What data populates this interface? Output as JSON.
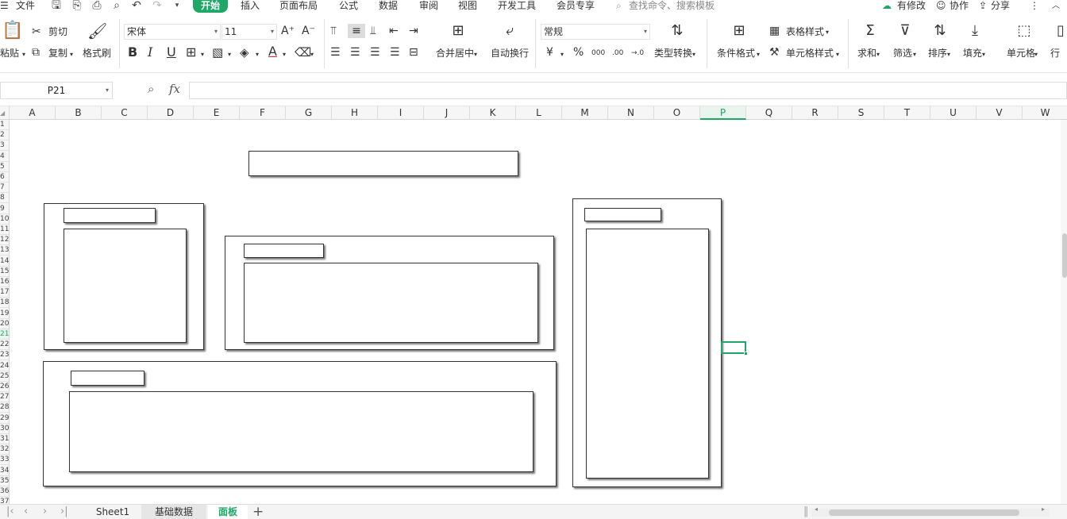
{
  "menu": {
    "file_label": "文件",
    "tabs": [
      "开始",
      "插入",
      "页面布局",
      "公式",
      "数据",
      "审阅",
      "视图",
      "开发工具",
      "会员专享"
    ],
    "search_placeholder": "查找命令、搜索模板",
    "right_items": {
      "modified": "有修改",
      "collab": "协作",
      "share": "分享"
    }
  },
  "ribbon": {
    "paste": "粘贴",
    "cut": "剪切",
    "copy": "复制",
    "format_painter": "格式刷",
    "font_name": "宋体",
    "font_size": "11",
    "merge_center": "合并居中",
    "wrap_text": "自动换行",
    "number_format": "常规",
    "type_convert": "类型转换",
    "conditional_format": "条件格式",
    "table_style": "表格样式",
    "cell_style": "单元格样式",
    "sum": "求和",
    "filter": "筛选",
    "sort": "排序",
    "fill": "填充",
    "cells": "单元格",
    "rows_cols": "行",
    "font_buttons": [
      "B",
      "I",
      "U"
    ],
    "currency_symbol": "¥",
    "percent_symbol": "%",
    "thousands_symbol": "000",
    "dec_increase": ".00",
    "dec_decrease": "→.0"
  },
  "formula_bar": {
    "cell_ref": "P21",
    "fx": "fx",
    "content": ""
  },
  "columns": [
    "A",
    "B",
    "C",
    "D",
    "E",
    "F",
    "G",
    "H",
    "I",
    "J",
    "K",
    "L",
    "M",
    "N",
    "O",
    "P",
    "Q",
    "R",
    "S",
    "T",
    "U",
    "V",
    "W"
  ],
  "selected_column": "P",
  "rows": [
    "1",
    "2",
    "3",
    "4",
    "5",
    "6",
    "7",
    "8",
    "9",
    "10",
    "11",
    "12",
    "13",
    "14",
    "15",
    "16",
    "17",
    "18",
    "19",
    "20",
    "21",
    "22",
    "23",
    "24",
    "25",
    "26",
    "27",
    "28",
    "29",
    "30",
    "31",
    "32",
    "33",
    "34",
    "35",
    "36",
    "37"
  ],
  "selected_row": "21",
  "sheets": [
    {
      "name": "Sheet1",
      "active": false
    },
    {
      "name": "基础数据",
      "active": false
    },
    {
      "name": "面板",
      "active": true
    }
  ],
  "colors": {
    "accent": "#1ea867"
  }
}
